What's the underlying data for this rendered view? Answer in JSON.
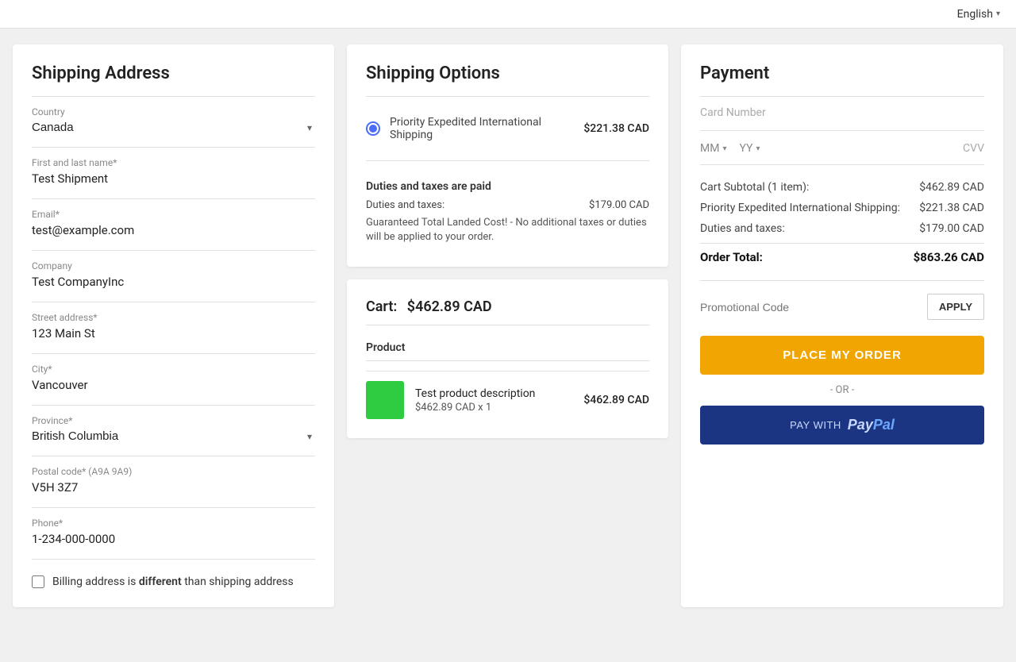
{
  "topbar": {
    "language": "English",
    "chevron": "▾"
  },
  "shipping_address": {
    "title": "Shipping Address",
    "country_label": "Country",
    "country_value": "Canada",
    "name_label": "First and last name*",
    "name_value": "Test Shipment",
    "email_label": "Email*",
    "email_value": "test@example.com",
    "company_label": "Company",
    "company_value": "Test CompanyInc",
    "street_label": "Street address*",
    "street_value": "123 Main St",
    "city_label": "City*",
    "city_value": "Vancouver",
    "province_label": "Province*",
    "province_value": "British Columbia",
    "postal_label": "Postal code* (A9A 9A9)",
    "postal_value": "V5H 3Z7",
    "phone_label": "Phone*",
    "phone_value": "1-234-000-0000",
    "billing_checkbox_label": "Billing address is",
    "billing_different": "different",
    "billing_suffix": "than shipping address"
  },
  "shipping_options": {
    "title": "Shipping Options",
    "option_label": "Priority Expedited International Shipping",
    "option_price": "$221.38 CAD",
    "duties_title": "Duties and taxes are paid",
    "duties_label": "Duties and taxes:",
    "duties_price": "$179.00 CAD",
    "duties_note": "Guaranteed Total Landed Cost! - No additional taxes or duties will be applied to your order."
  },
  "cart": {
    "title": "Cart:",
    "total": "$462.89 CAD",
    "product_header": "Product",
    "product_name": "Test product description",
    "product_price": "$462.89 CAD",
    "product_qty": "$462.89 CAD x 1"
  },
  "payment": {
    "title": "Payment",
    "card_number_label": "Card Number",
    "expiry_mm": "MM",
    "expiry_yy": "YY",
    "cvv_label": "CVV",
    "subtotal_label": "Cart Subtotal (1 item):",
    "subtotal_price": "$462.89 CAD",
    "shipping_label": "Priority Expedited International Shipping:",
    "shipping_price": "$221.38 CAD",
    "duties_label": "Duties and taxes:",
    "duties_price": "$179.00 CAD",
    "order_total_label": "Order Total:",
    "order_total_price": "$863.26 CAD",
    "promo_placeholder": "Promotional Code",
    "apply_btn": "APPLY",
    "place_order_btn": "PLACE MY ORDER",
    "or_text": "- OR -",
    "paypal_pre": "PAY WITH",
    "paypal_logo_pay": "Pay",
    "paypal_logo_pal": "Pal"
  }
}
